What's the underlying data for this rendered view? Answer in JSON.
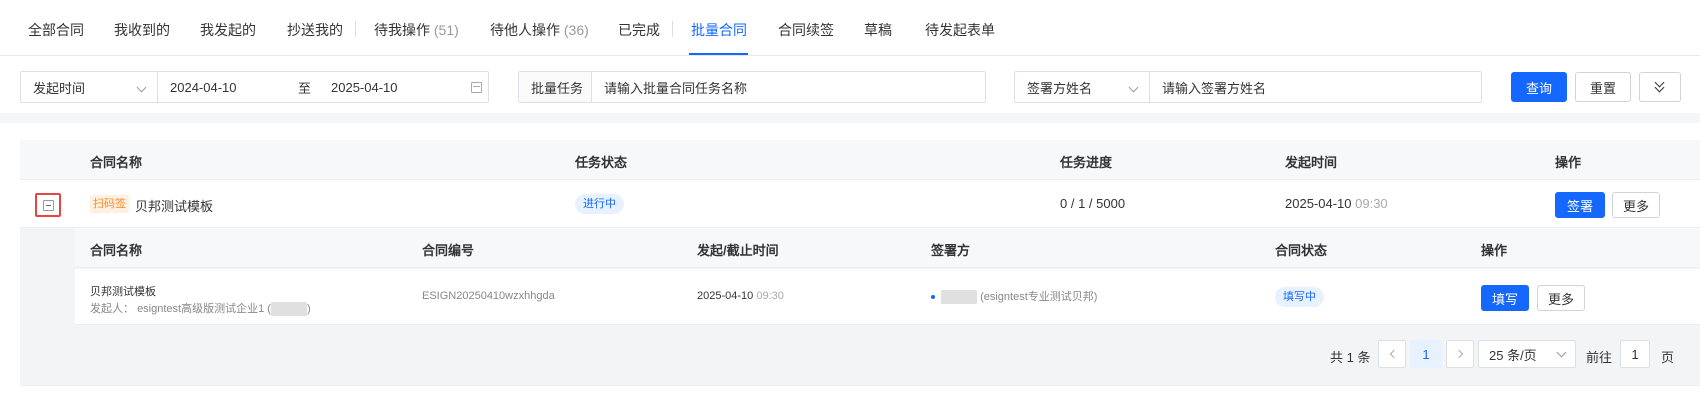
{
  "tabs": {
    "all": "全部合同",
    "received": "我收到的",
    "initiated": "我发起的",
    "cc": "抄送我的",
    "pending_me": "待我操作",
    "pending_me_count": "(51)",
    "pending_others": "待他人操作",
    "pending_others_count": "(36)",
    "completed": "已完成",
    "batch": "批量合同",
    "renewal": "合同续签",
    "draft": "草稿",
    "pending_form": "待发起表单"
  },
  "filters": {
    "time_field": "发起时间",
    "start_date": "2024-04-10",
    "to": "至",
    "end_date": "2025-04-10",
    "batch_label": "批量任务",
    "batch_placeholder": "请输入批量合同任务名称",
    "signer_field": "签署方姓名",
    "signer_placeholder": "请输入签署方姓名",
    "search": "查询",
    "reset": "重置"
  },
  "main_table": {
    "headers": {
      "name": "合同名称",
      "status": "任务状态",
      "progress": "任务进度",
      "time": "发起时间",
      "action": "操作"
    },
    "row": {
      "tag": "扫码签",
      "name": "贝邦测试模板",
      "status": "进行中",
      "progress": "0 / 1 / 5000",
      "date": "2025-04-10",
      "time": "09:30",
      "sign": "签署",
      "more": "更多"
    }
  },
  "sub_table": {
    "headers": {
      "name": "合同名称",
      "code": "合同编号",
      "time": "发起/截止时间",
      "signer": "签署方",
      "status": "合同状态",
      "action": "操作"
    },
    "row": {
      "name": "贝邦测试模板",
      "initiator_label": "发起人：",
      "initiator": "esigntest高级版测试企业1 (",
      "initiator_close": ")",
      "code": "ESIGN20250410wzxhhgda",
      "date": "2025-04-10",
      "time": "09:30",
      "signer_org": "(esigntest专业测试贝邦)",
      "status": "填写中",
      "fill": "填写",
      "more": "更多"
    }
  },
  "pagination": {
    "total": "共 1 条",
    "page": "1",
    "page_size": "25 条/页",
    "goto": "前往",
    "goto_value": "1",
    "page_unit": "页"
  }
}
